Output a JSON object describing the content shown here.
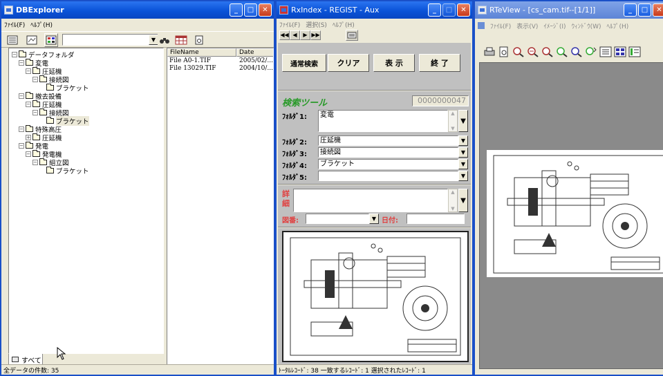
{
  "db": {
    "title": "DBExplorer",
    "menu": [
      "ﾌｧｲﾙ(F)",
      "ﾍﾙﾌﾟ(H)"
    ],
    "tree": [
      {
        "label": "データフォルダ",
        "level": 0,
        "exp": "−"
      },
      {
        "label": "変電",
        "level": 1,
        "exp": "−"
      },
      {
        "label": "圧延機",
        "level": 2,
        "exp": "−"
      },
      {
        "label": "接続図",
        "level": 3,
        "exp": "−"
      },
      {
        "label": "ブラケット",
        "level": 4,
        "exp": ""
      },
      {
        "label": "撤去設備",
        "level": 1,
        "exp": "−"
      },
      {
        "label": "圧延機",
        "level": 2,
        "exp": "−"
      },
      {
        "label": "接続図",
        "level": 3,
        "exp": "−"
      },
      {
        "label": "ブラケット",
        "level": 4,
        "exp": "",
        "selected": true
      },
      {
        "label": "特殊高圧",
        "level": 1,
        "exp": "−"
      },
      {
        "label": "圧延機",
        "level": 2,
        "exp": "+"
      },
      {
        "label": "発電",
        "level": 1,
        "exp": "−"
      },
      {
        "label": "発電機",
        "level": 2,
        "exp": "−"
      },
      {
        "label": "組立図",
        "level": 3,
        "exp": "−"
      },
      {
        "label": "ブラケット",
        "level": 4,
        "exp": ""
      }
    ],
    "columns": [
      "FileName",
      "Date"
    ],
    "files": [
      {
        "name": "File A0-1.TIF",
        "date": "2005/02/..."
      },
      {
        "name": "File 13029.TIF",
        "date": "2004/10/..."
      }
    ],
    "tab": "すべて",
    "status": "全データの件数: 35"
  },
  "rx": {
    "title": "RxIndex - REGIST - Aux",
    "menu": [
      "ﾌｧｲﾙ(F)",
      "選択(S)",
      "ﾍﾙﾌﾟ(H)"
    ],
    "buttons": {
      "search": "通常検索",
      "clear": "クリア",
      "show": "表 示",
      "end": "終 了"
    },
    "tool_title": "検索ツール",
    "counter": "0000000047",
    "folders": [
      {
        "label": "ﾌｫﾙﾀﾞ1:",
        "value": "変電"
      },
      {
        "label": "ﾌｫﾙﾀﾞ2:",
        "value": "圧延機"
      },
      {
        "label": "ﾌｫﾙﾀﾞ3:",
        "value": "接続図"
      },
      {
        "label": "ﾌｫﾙﾀﾞ4:",
        "value": "ブラケット"
      },
      {
        "label": "ﾌｫﾙﾀﾞ5:",
        "value": ""
      }
    ],
    "detail_label": "詳細",
    "drawing_no_label": "図番:",
    "date_label": "日付:",
    "status": "ﾄｰﾀﾙﾚｺｰﾄﾞ: 38 一致するﾚｺｰﾄﾞ: 1 選択されたﾚｺｰﾄﾞ: 1"
  },
  "rt": {
    "title": "RTeView - [cs_cam.tif--[1/1]]",
    "menu": [
      "ﾌｧｲﾙ(F)",
      "表示(V)",
      "ｲﾒｰｼﾞ(I)",
      "ｳｨﾝﾄﾞｳ(W)",
      "ﾍﾙﾌﾟ(H)"
    ]
  },
  "colors": {
    "title_blue": "#0a53d8",
    "desktop": "#f1b80c",
    "tool_green": "#2a9a2a",
    "counter_text": "#8a8a8a",
    "red_label": "#e04040"
  }
}
